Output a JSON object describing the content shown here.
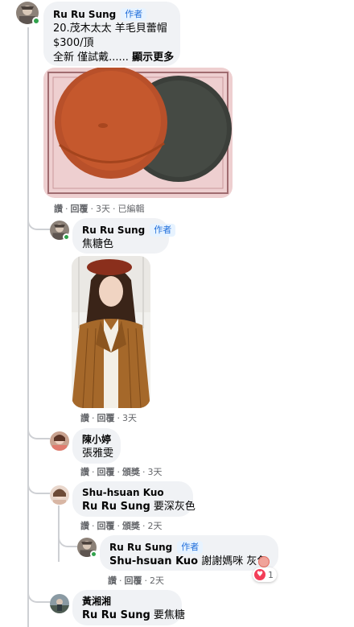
{
  "colors": {
    "bubble_bg": "#f0f2f5",
    "author_badge_bg": "#e7f3ff",
    "author_badge_fg": "#216fdb",
    "meta_text": "#65676b",
    "online": "#31a24c",
    "heart": "#f33e58"
  },
  "comments": [
    {
      "id": "c1",
      "author": "Ru Ru Sung",
      "badge": "作者",
      "lines": [
        "20.茂木太太 羊毛貝蕾帽",
        "$300/頂",
        "全新 僅試戴......"
      ],
      "see_more": "顯示更多",
      "photo_icon": "berets-photo",
      "actions": {
        "like": "讚",
        "reply": "回覆",
        "time": "3天",
        "edited": "已編輯"
      }
    },
    {
      "id": "c2",
      "author": "Ru Ru Sung",
      "badge": "作者",
      "text": "焦糖色",
      "photo_icon": "model-with-beret-photo",
      "actions": {
        "like": "讚",
        "reply": "回覆",
        "time": "3天"
      }
    },
    {
      "id": "c3",
      "author": "陳小婷",
      "text": "張雅雯",
      "actions": {
        "like": "讚",
        "reply": "回覆",
        "translate": "頒獎",
        "time": "3天"
      }
    },
    {
      "id": "c4",
      "author": "Shu-hsuan Kuo",
      "mention": "Ru Ru Sung",
      "text": " 要深灰色",
      "actions": {
        "like": "讚",
        "reply": "回覆",
        "translate": "頒獎",
        "time": "2天"
      }
    },
    {
      "id": "c5",
      "author": "Ru Ru Sung",
      "badge": "作者",
      "mention": "Shu-hsuan Kuo",
      "text": " 謝謝媽咪 灰色",
      "reaction_icon": "heart-icon",
      "reaction_count": "1",
      "actions": {
        "like": "讚",
        "reply": "回覆",
        "time": "2天"
      }
    },
    {
      "id": "c6",
      "author": "黃湘湘",
      "mention": "Ru Ru Sung",
      "text": " 要焦糖"
    }
  ]
}
